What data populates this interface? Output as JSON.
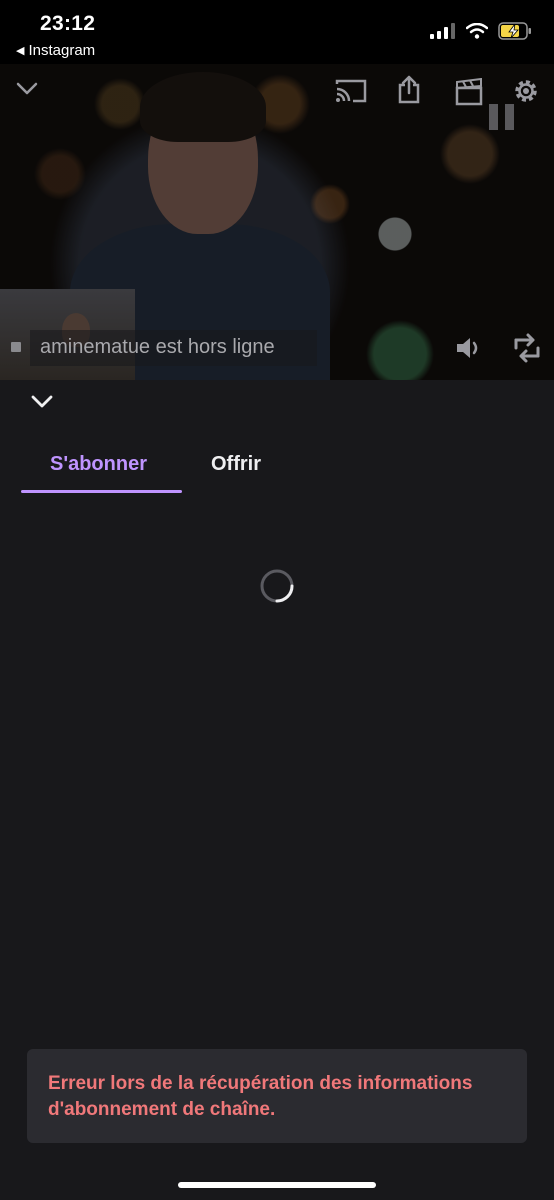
{
  "status_bar": {
    "time": "23:12",
    "back_app": "Instagram"
  },
  "video": {
    "offline_message": "aminematue est hors ligne"
  },
  "tabs": [
    {
      "label": "S'abonner",
      "active": true
    },
    {
      "label": "Offrir",
      "active": false
    }
  ],
  "error": {
    "message": "Erreur lors de la récupération des informations d'abonnement de chaîne."
  },
  "colors": {
    "accent": "#bf94ff",
    "error": "#f0787a",
    "background": "#18181b",
    "toast": "#2b2b30"
  },
  "icons": [
    "cast-icon",
    "share-icon",
    "clip-icon",
    "gear-icon",
    "pause-icon",
    "volume-icon",
    "rotate-icon",
    "chevron-down-icon"
  ]
}
